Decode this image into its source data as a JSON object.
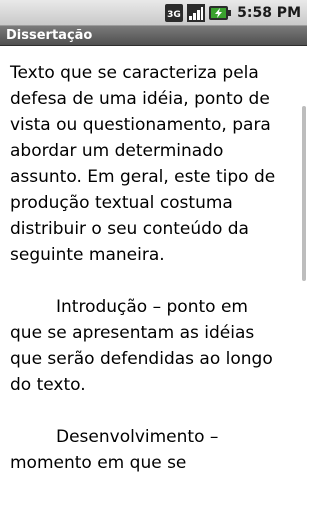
{
  "status_bar": {
    "network_label": "3G",
    "time": "5:58 PM",
    "icons": [
      "3g-network-icon",
      "signal-strength-icon",
      "battery-charging-icon"
    ]
  },
  "title_bar": {
    "title": "Dissertação"
  },
  "content": {
    "paragraphs": [
      "Texto que se caracteriza pela defesa de uma idéia, ponto de vista ou questionamento, para abordar um determinado assunto. Em geral, este tipo de produção textual costuma distribuir o seu conteúdo da seguinte maneira.",
      "Introdução – ponto em que se apresentam as idéias que serão defendidas ao longo do texto.",
      "Desenvolvimento – momento em que se"
    ]
  },
  "colors": {
    "status_bar": "#d6d6d6",
    "title_bar": "#5f5f5f",
    "content_background": "#ffffff",
    "text": "#000000",
    "battery_accent": "#3aa12e"
  }
}
